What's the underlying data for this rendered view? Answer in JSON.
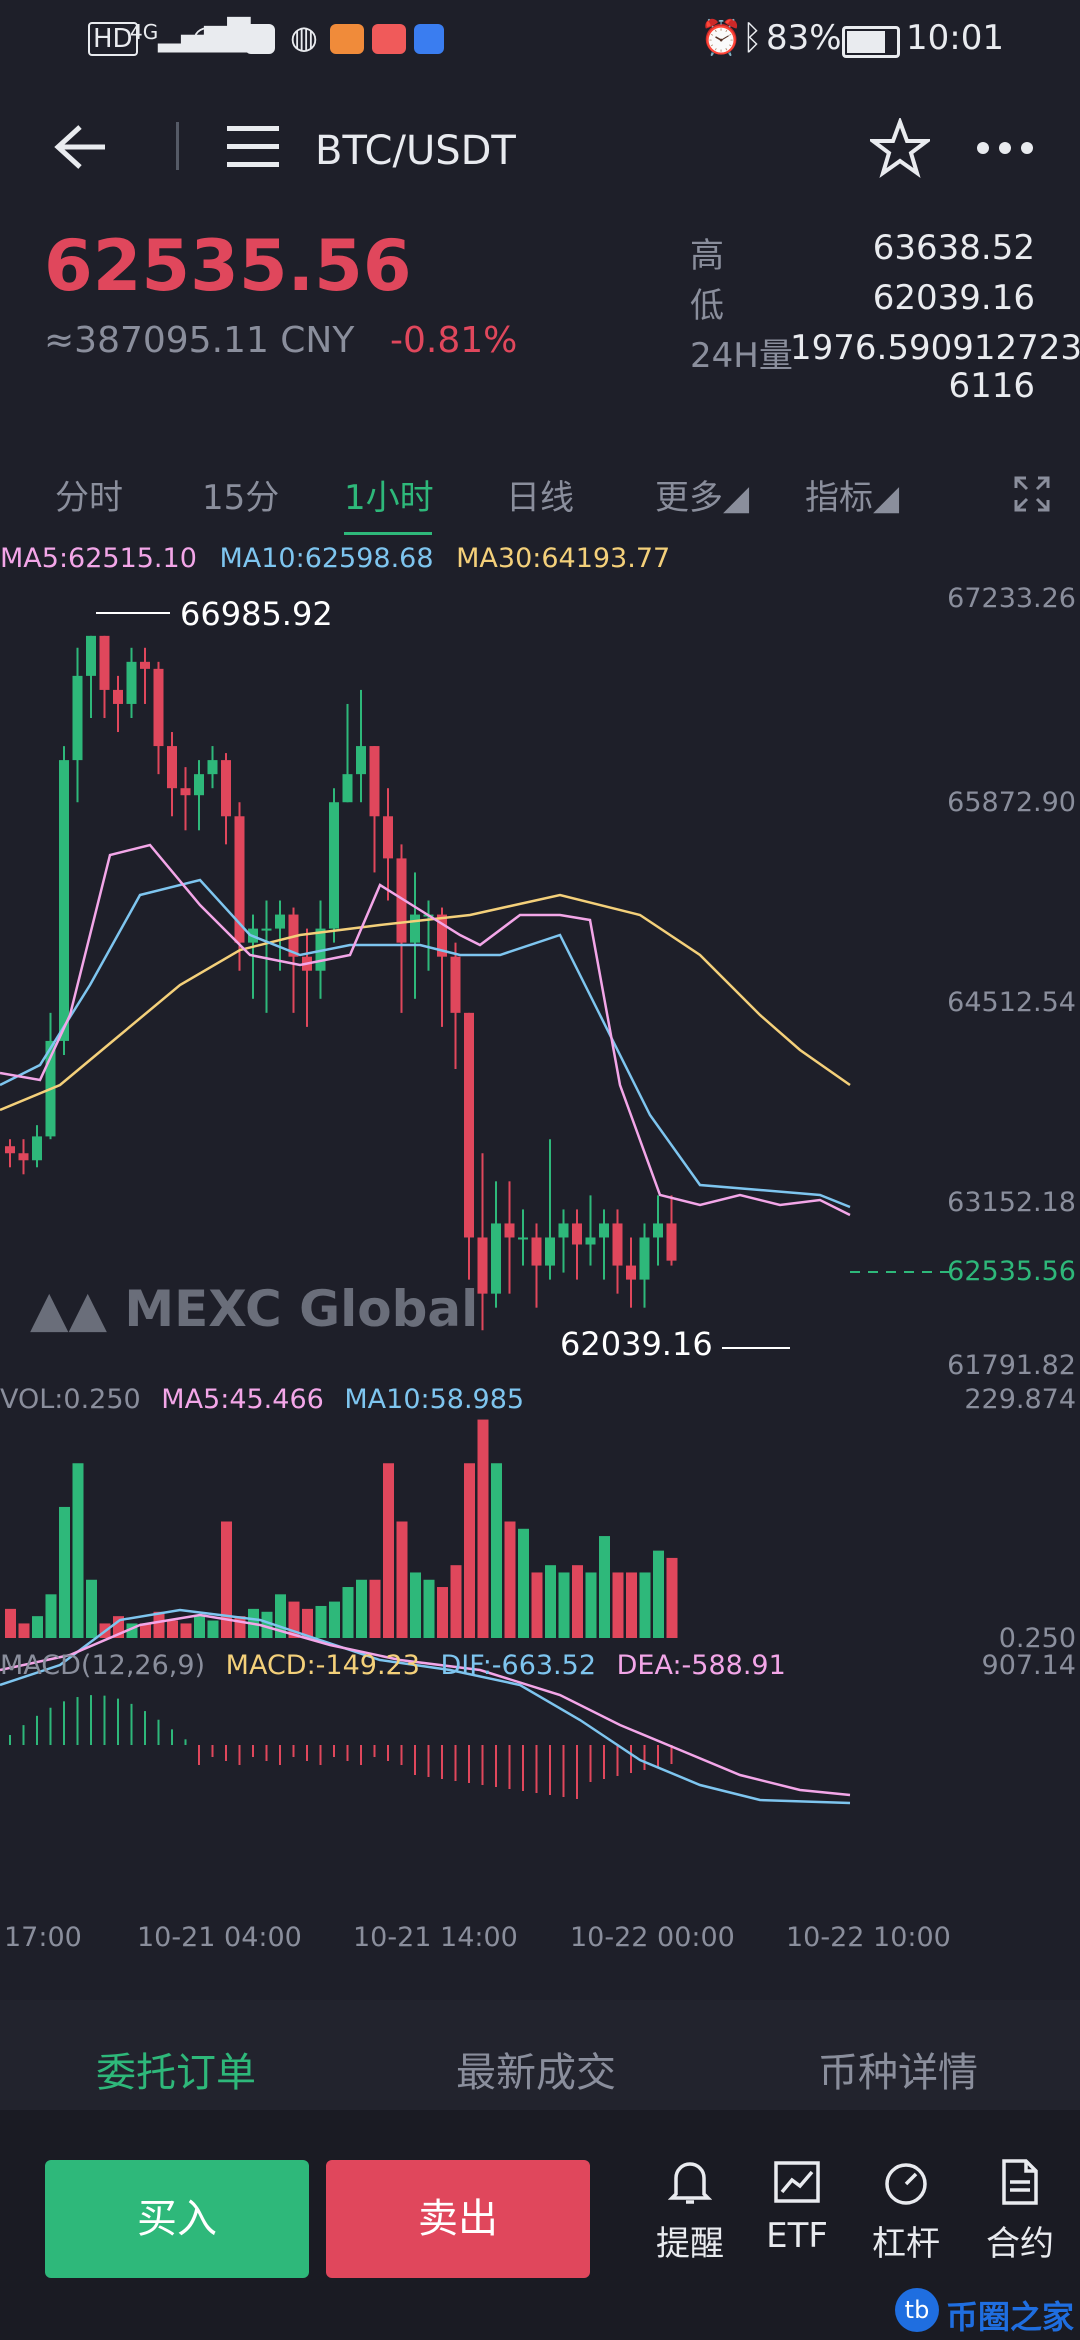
{
  "status_bar": {
    "left_icons": [
      "hd-icon",
      "signal-4g-icon",
      "wifi-icon",
      "huawei-app-icon",
      "basketball-app-icon",
      "app-icon-orange",
      "huawei-red-app-icon",
      "bulb-app-icon"
    ],
    "hd": "HD",
    "net": "4G",
    "notify_count": "1",
    "battery": "83%",
    "time": "10:01"
  },
  "header": {
    "pair": "BTC/USDT"
  },
  "ticker": {
    "price": "62535.56",
    "cny": "≈387095.11 CNY",
    "change": "-0.81%",
    "high_label": "高",
    "high": "63638.52",
    "low_label": "低",
    "low": "62039.16",
    "vol24_label": "24H量",
    "vol24_line1": "1976.590912723",
    "vol24_line2": "6116"
  },
  "timeframes": {
    "items": [
      "分时",
      "15分",
      "1小时",
      "日线",
      "更多◢",
      "指标◢"
    ],
    "active_index": 2
  },
  "main_chart": {
    "ma_legend": {
      "ma5": "MA5:62515.10",
      "ma10": "MA10:62598.68",
      "ma30": "MA30:64193.77"
    },
    "y_ticks": [
      "67233.26",
      "65872.90",
      "64512.54",
      "63152.18",
      "61791.82"
    ],
    "current_price_tag": "62535.56",
    "high_marker": "66985.92",
    "low_marker": "62039.16",
    "watermark": "MEXC Global",
    "colors": {
      "up": "#2eb87a",
      "down": "#e0475c",
      "ma5": "#f3a6e8",
      "ma10": "#7ec5ef",
      "ma30": "#f4d07a"
    }
  },
  "vol_chart": {
    "legend": {
      "vol": "VOL:0.250",
      "ma5": "MA5:45.466",
      "ma10": "MA10:58.985"
    },
    "max_tick": "229.874",
    "min_tick": "0.250"
  },
  "macd_chart": {
    "legend": {
      "title": "MACD(12,26,9)",
      "macd": "MACD:-149.23",
      "dif": "DIF:-663.52",
      "dea": "DEA:-588.91"
    },
    "max_tick": "907.14"
  },
  "x_ticks": [
    "17:00",
    "10-21 04:00",
    "10-21 14:00",
    "10-22 00:00",
    "10-22 10:00"
  ],
  "bottom_tabs": {
    "items": [
      "委托订单",
      "最新成交",
      "币种详情"
    ],
    "active_index": 0
  },
  "footer": {
    "buy": "买入",
    "sell": "卖出",
    "actions": [
      "提醒",
      "ETF",
      "杠杆",
      "合约"
    ]
  },
  "watermark_corner": "币圈之家",
  "watermark_corner_badge": "tb"
}
